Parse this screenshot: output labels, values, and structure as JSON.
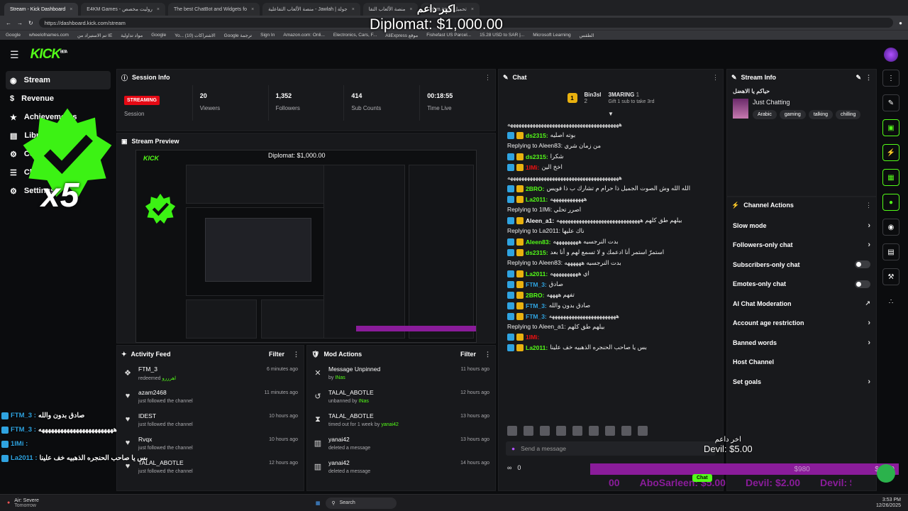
{
  "browser": {
    "tabs": [
      {
        "label": "Stream - Kick Dashboard",
        "active": true
      },
      {
        "label": "E4KM Games - روليت مخصص"
      },
      {
        "label": "The best ChatBot and Widgets fo"
      },
      {
        "label": "منصة الألعاب التفاعلية - Jawlah | جولة"
      },
      {
        "label": "منصة الألعاب التفا"
      },
      {
        "label": "Obhm.app | تحميل"
      }
    ],
    "url": "https://dashboard.kick.com/stream",
    "bookmarks": [
      "Google",
      "wheelofnames.com",
      "تم الاستيراد من IE",
      "مواد تداولية",
      "Google",
      "Yo... الاشتراكات (10)",
      "Google ترجمة",
      "Sign In",
      "Amazon.com: Onli...",
      "Electronics, Cars, F...",
      "AliExpress موقع",
      "Fishefast US Parcel...",
      "15.28 USD to SAR |...",
      "Microsoft Learning",
      "الطقس"
    ]
  },
  "overlay": {
    "top_name": "اكبر داعم",
    "top_amount": "Diplomat: $1,000.00",
    "badge_multiplier": "x5",
    "bottom_right_name": "اخر داعم",
    "bottom_right_amount": "Devil: $5.00",
    "goal_left": "$980",
    "goal_right": "$1000",
    "ticker": [
      "00",
      "AboSarleen: $5.00",
      "Devil: $2.00",
      "Devil: $"
    ]
  },
  "app": {
    "logo": "KICK",
    "logo_sup": "BETA"
  },
  "sidebar": {
    "items": [
      {
        "label": "Stream",
        "icon": "stream-icon"
      },
      {
        "label": "Revenue",
        "icon": "revenue-icon"
      },
      {
        "label": "Achievements",
        "icon": "trophy-icon"
      },
      {
        "label": "Library",
        "icon": "library-icon"
      },
      {
        "label": "Community",
        "icon": "community-icon"
      },
      {
        "label": "Channel",
        "icon": "channel-icon"
      },
      {
        "label": "Settings",
        "icon": "settings-icon"
      }
    ]
  },
  "session": {
    "title": "Session Info",
    "status": "STREAMING",
    "status_label": "Session",
    "stats": [
      {
        "value": "20",
        "label": "Viewers"
      },
      {
        "value": "1,352",
        "label": "Followers"
      },
      {
        "value": "414",
        "label": "Sub Counts"
      },
      {
        "value": "00:18:55",
        "label": "Time Live"
      }
    ]
  },
  "preview": {
    "title": "Stream Preview"
  },
  "activity": {
    "title": "Activity Feed",
    "filter": "Filter",
    "items": [
      {
        "name": "FTM_3",
        "detail": "redeemed",
        "hl": "اهرررو",
        "time": "6 minutes ago"
      },
      {
        "name": "azam2468",
        "detail": "just followed the channel",
        "hl": "",
        "time": "11 minutes ago"
      },
      {
        "name": "IDEST",
        "detail": "just followed the channel",
        "hl": "",
        "time": "10 hours ago"
      },
      {
        "name": "Rvqx",
        "detail": "just followed the channel",
        "hl": "",
        "time": "10 hours ago"
      },
      {
        "name": "TALAL_ABOTLE",
        "detail": "just followed the channel",
        "hl": "",
        "time": "12 hours ago"
      }
    ]
  },
  "mod": {
    "title": "Mod Actions",
    "filter": "Filter",
    "items": [
      {
        "name": "Message Unpinned",
        "detail": "by",
        "hl": "INas",
        "time": "11 hours ago"
      },
      {
        "name": "TALAL_ABOTLE",
        "detail": "unbanned by",
        "hl": "INas",
        "time": "12 hours ago"
      },
      {
        "name": "TALAL_ABOTLE",
        "detail": "timed out for 1 week by",
        "hl": "yanai42",
        "time": "13 hours ago"
      },
      {
        "name": "yanai42",
        "detail": "deleted a message",
        "hl": "",
        "time": "13 hours ago"
      },
      {
        "name": "yanai42",
        "detail": "deleted a message",
        "hl": "",
        "time": "14 hours ago"
      }
    ]
  },
  "chat": {
    "title": "Chat",
    "top1": "Bin3sl",
    "top1_count": "2",
    "top2": "3MARING",
    "top2_count": "1",
    "gift_text": "Gift 1 sub to take 3rd",
    "input_placeholder": "Send a message",
    "send_label": "Chat",
    "count": "0",
    "messages": [
      {
        "reply": "",
        "name": "",
        "color": "#fff",
        "text": "ههههههههههههههههههههههههههههههههههههههههه"
      },
      {
        "reply": "",
        "name": "ds2315:",
        "color": "#53fc18",
        "text": "بوته اصليه"
      },
      {
        "reply": "Replying to Aleen83: من زمان شري",
        "name": "ds2315:",
        "color": "#53fc18",
        "text": "شكرا"
      },
      {
        "reply": "",
        "name": "1IMi:",
        "color": "#e11",
        "text": "اخخ الين"
      },
      {
        "reply": "",
        "name": "",
        "color": "#fff",
        "text": "ههههههههههههههههههههههههههههههههههههههههه"
      },
      {
        "reply": "",
        "name": "2BRO:",
        "color": "#53fc18",
        "text": "الله الله وش الصوت الجميل ذا حرام م تشارك ب ذا فويس"
      },
      {
        "reply": "",
        "name": "La2011:",
        "color": "#53fc18",
        "text": "ههههههههههههه"
      },
      {
        "reply": "Replying to 1IMi: اصرر تحلي",
        "name": "Aleen_a1:",
        "color": "#fff",
        "text": "بيلهم طق كلهم ههههههههههههههههههههههههههههههه"
      },
      {
        "reply": "Replying to La2011: ناك عليها",
        "name": "Aleen83:",
        "color": "#53fc18",
        "text": "بدت النرجسيه هههههههههه"
      },
      {
        "reply": "",
        "name": "ds2315:",
        "color": "#53fc18",
        "text": "استمرّ استمر أنا ادعمك و لا تسمع لهم و أنا بعد"
      },
      {
        "reply": "Replying to Aleen83: بدت النرجسيه ههههههه",
        "name": "La2011:",
        "color": "#53fc18",
        "text": "اي ههههههههههه"
      },
      {
        "reply": "",
        "name": "FTM_3:",
        "color": "#2fa3e0",
        "text": "صادق"
      },
      {
        "reply": "",
        "name": "2BRO:",
        "color": "#53fc18",
        "text": "تفهم ههههه"
      },
      {
        "reply": "",
        "name": "FTM_3:",
        "color": "#2fa3e0",
        "text": "صادق بدون والله"
      },
      {
        "reply": "",
        "name": "FTM_3:",
        "color": "#2fa3e0",
        "text": "ههههههههههههههههههههههههه"
      },
      {
        "reply": "Replying to Aleen_a1: بيلهم طق كلهم",
        "name": "1IMi:",
        "color": "#e11",
        "text": ""
      },
      {
        "reply": "",
        "name": "La2011:",
        "color": "#53fc18",
        "text": "بس يا صاحب الحنجره الذهبيه خف علينا"
      }
    ]
  },
  "stream_info": {
    "title": "Stream Info",
    "stream_title": "حياكم يا الاهضل",
    "category": "Just Chatting",
    "tags": [
      "Arabic",
      "gaming",
      "talking",
      "chilling"
    ]
  },
  "channel_actions": {
    "title": "Channel Actions",
    "items": [
      {
        "label": "Slow mode",
        "kind": "arrow"
      },
      {
        "label": "Followers-only chat",
        "kind": "arrow"
      },
      {
        "label": "Subscribers-only chat",
        "kind": "toggle"
      },
      {
        "label": "Emotes-only chat",
        "kind": "toggle"
      },
      {
        "label": "AI Chat Moderation",
        "kind": "external"
      },
      {
        "label": "Account age restriction",
        "kind": "arrow"
      },
      {
        "label": "Banned words",
        "kind": "arrow"
      },
      {
        "label": "Host Channel",
        "kind": "none"
      },
      {
        "label": "Set goals",
        "kind": "arrow"
      }
    ]
  },
  "float_chat": [
    {
      "name": "FTM_3 :",
      "text": "صادق بدون والله"
    },
    {
      "name": "FTM_3 :",
      "text": "ههههههههههههههههههههههههه"
    },
    {
      "name": "1IMi :",
      "text": ""
    },
    {
      "name": "La2011 :",
      "text": "بس يا صاحب الحنجره الذهبيه خف علينا"
    }
  ],
  "taskbar": {
    "weather": "Air: Severe",
    "weather_sub": "Tomorrow",
    "search": "Search",
    "time": "3:53 PM",
    "date": "12/26/2025"
  }
}
